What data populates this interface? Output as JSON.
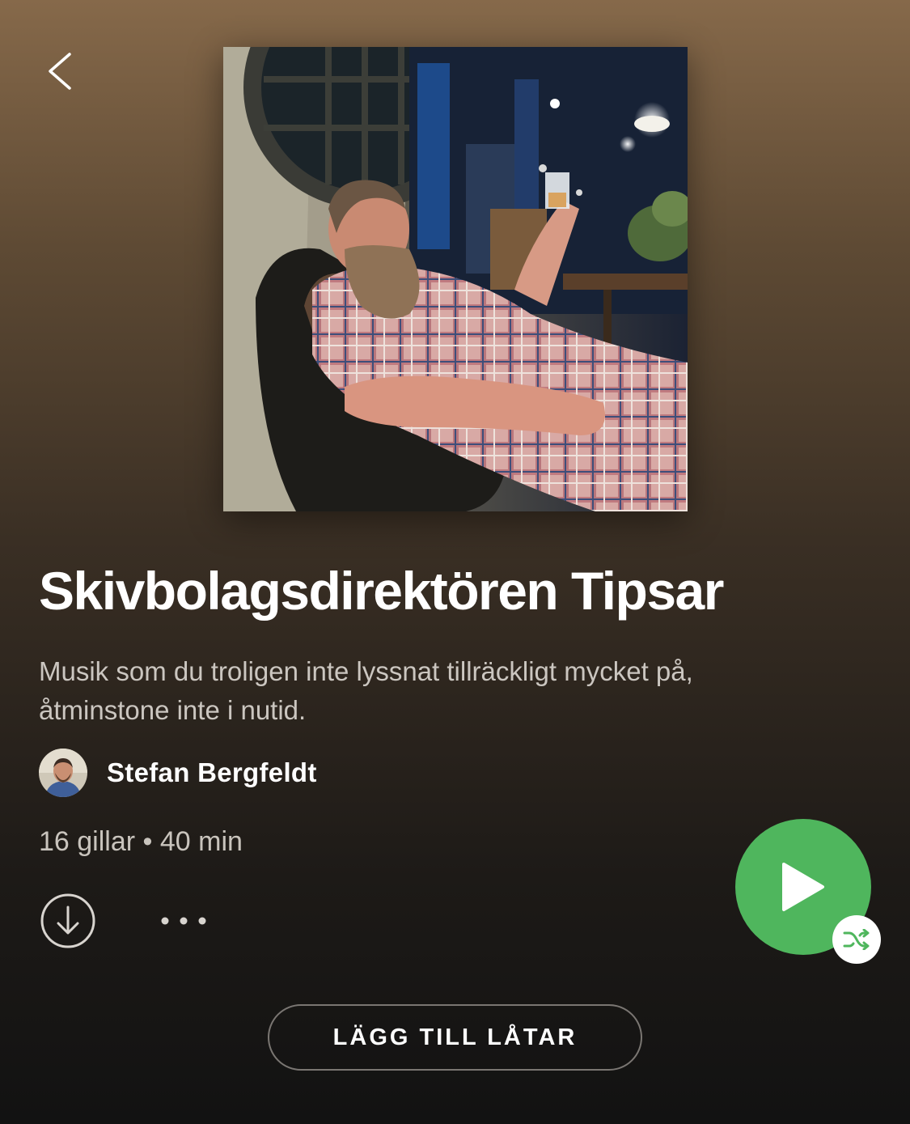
{
  "header": {
    "back_icon": "chevron-left-icon"
  },
  "playlist": {
    "cover_image": "man-with-beard-in-plaid-shirt-holding-glass",
    "title": "Skivbolagsdirektören Tipsar",
    "description": "Musik som du troligen inte lyssnat tillräckligt mycket på, åtminstone inte i nutid.",
    "owner": {
      "name": "Stefan Bergfeldt",
      "avatar": "profile-photo"
    },
    "meta": "16 gillar • 40 min"
  },
  "actions": {
    "download_icon": "download-circle-icon",
    "more_icon": "more-options-icon",
    "play_icon": "play-icon",
    "shuffle_icon": "shuffle-icon",
    "add_songs_label": "LÄGG TILL LÅTAR"
  },
  "colors": {
    "accent": "#4fb65d",
    "background_top": "#86694a",
    "background_bottom": "#121212",
    "text_secondary": "#cbc6c0"
  }
}
